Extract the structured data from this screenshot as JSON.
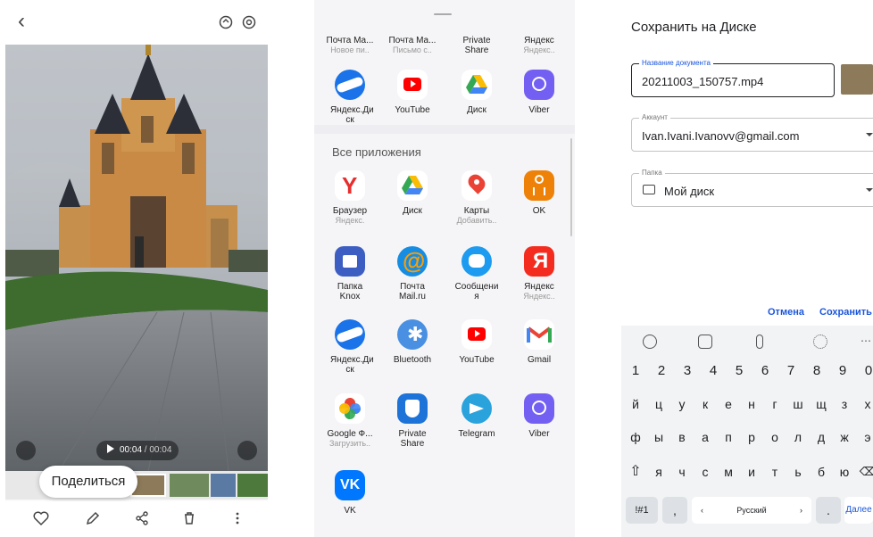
{
  "viewer": {
    "tooltip": "Поделиться",
    "time_current": "00:04",
    "time_separator": " / ",
    "time_total": "00:04",
    "icons": [
      "back-icon",
      "rotate-icon",
      "lens-icon",
      "capture-icon",
      "volume-icon",
      "heart-icon",
      "edit-icon",
      "share-icon",
      "trash-icon",
      "more-icon"
    ]
  },
  "share_sheet": {
    "top_apps": [
      {
        "label": "Почта Ма...",
        "sub": "Новое пи.."
      },
      {
        "label": "Почта Ма...",
        "sub": "Письмо с.."
      },
      {
        "label": "Private Share",
        "sub": ""
      },
      {
        "label": "Яндекс",
        "sub": "Яндекс.."
      },
      {
        "label": "Яндекс.Ди ск",
        "sub": "",
        "icon": "yandex-disk-icon"
      },
      {
        "label": "YouTube",
        "sub": "",
        "icon": "youtube-icon"
      },
      {
        "label": "Диск",
        "sub": "",
        "icon": "google-drive-icon"
      },
      {
        "label": "Viber",
        "sub": "",
        "icon": "viber-icon"
      }
    ],
    "all_apps_title": "Все приложения",
    "all_apps": [
      {
        "label": "Браузер",
        "sub": "Яндекс.",
        "icon": "yandex-browser-icon"
      },
      {
        "label": "Диск",
        "sub": "",
        "icon": "google-drive-icon"
      },
      {
        "label": "Карты",
        "sub": "Добавить..",
        "icon": "google-maps-icon"
      },
      {
        "label": "OK",
        "sub": "",
        "icon": "odnoklassniki-icon"
      },
      {
        "label": "Папка Knox",
        "sub": "",
        "icon": "knox-folder-icon"
      },
      {
        "label": "Почта Mail.ru",
        "sub": "",
        "icon": "mailru-icon"
      },
      {
        "label": "Сообщени я",
        "sub": "",
        "icon": "messages-icon"
      },
      {
        "label": "Яндекс",
        "sub": "Яндекс..",
        "icon": "yandex-icon"
      },
      {
        "label": "Яндекс.Ди ск",
        "sub": "",
        "icon": "yandex-disk-icon"
      },
      {
        "label": "Bluetooth",
        "sub": "",
        "icon": "bluetooth-icon"
      },
      {
        "label": "YouTube",
        "sub": "",
        "icon": "youtube-icon"
      },
      {
        "label": "Gmail",
        "sub": "",
        "icon": "gmail-icon"
      },
      {
        "label": "Google Ф...",
        "sub": "Загрузить..",
        "icon": "google-photos-icon"
      },
      {
        "label": "Private Share",
        "sub": "",
        "icon": "private-share-icon"
      },
      {
        "label": "Telegram",
        "sub": "",
        "icon": "telegram-icon"
      },
      {
        "label": "Viber",
        "sub": "",
        "icon": "viber-icon"
      },
      {
        "label": "VK",
        "sub": "",
        "icon": "vk-icon"
      }
    ]
  },
  "drive_dialog": {
    "title": "Сохранить на Диске",
    "doc_label": "Название документа",
    "doc_value": "20211003_150757.mp4",
    "account_label": "Аккаунт",
    "account_value": "Ivan.Ivani.Ivanovv@gmail.com",
    "folder_label": "Папка",
    "folder_value": "Мой диск",
    "cancel": "Отмена",
    "save": "Сохранить"
  },
  "keyboard": {
    "numbers": [
      "1",
      "2",
      "3",
      "4",
      "5",
      "6",
      "7",
      "8",
      "9",
      "0"
    ],
    "row1": [
      "й",
      "ц",
      "у",
      "к",
      "е",
      "н",
      "г",
      "ш",
      "щ",
      "з",
      "х"
    ],
    "row2": [
      "ф",
      "ы",
      "в",
      "а",
      "п",
      "р",
      "о",
      "л",
      "д",
      "ж",
      "э"
    ],
    "row3": [
      "я",
      "ч",
      "с",
      "м",
      "и",
      "т",
      "ь",
      "б",
      "ю"
    ],
    "symbols": "!#1",
    "comma": ",",
    "space": "Русский",
    "period": ".",
    "enter": "Далее"
  }
}
